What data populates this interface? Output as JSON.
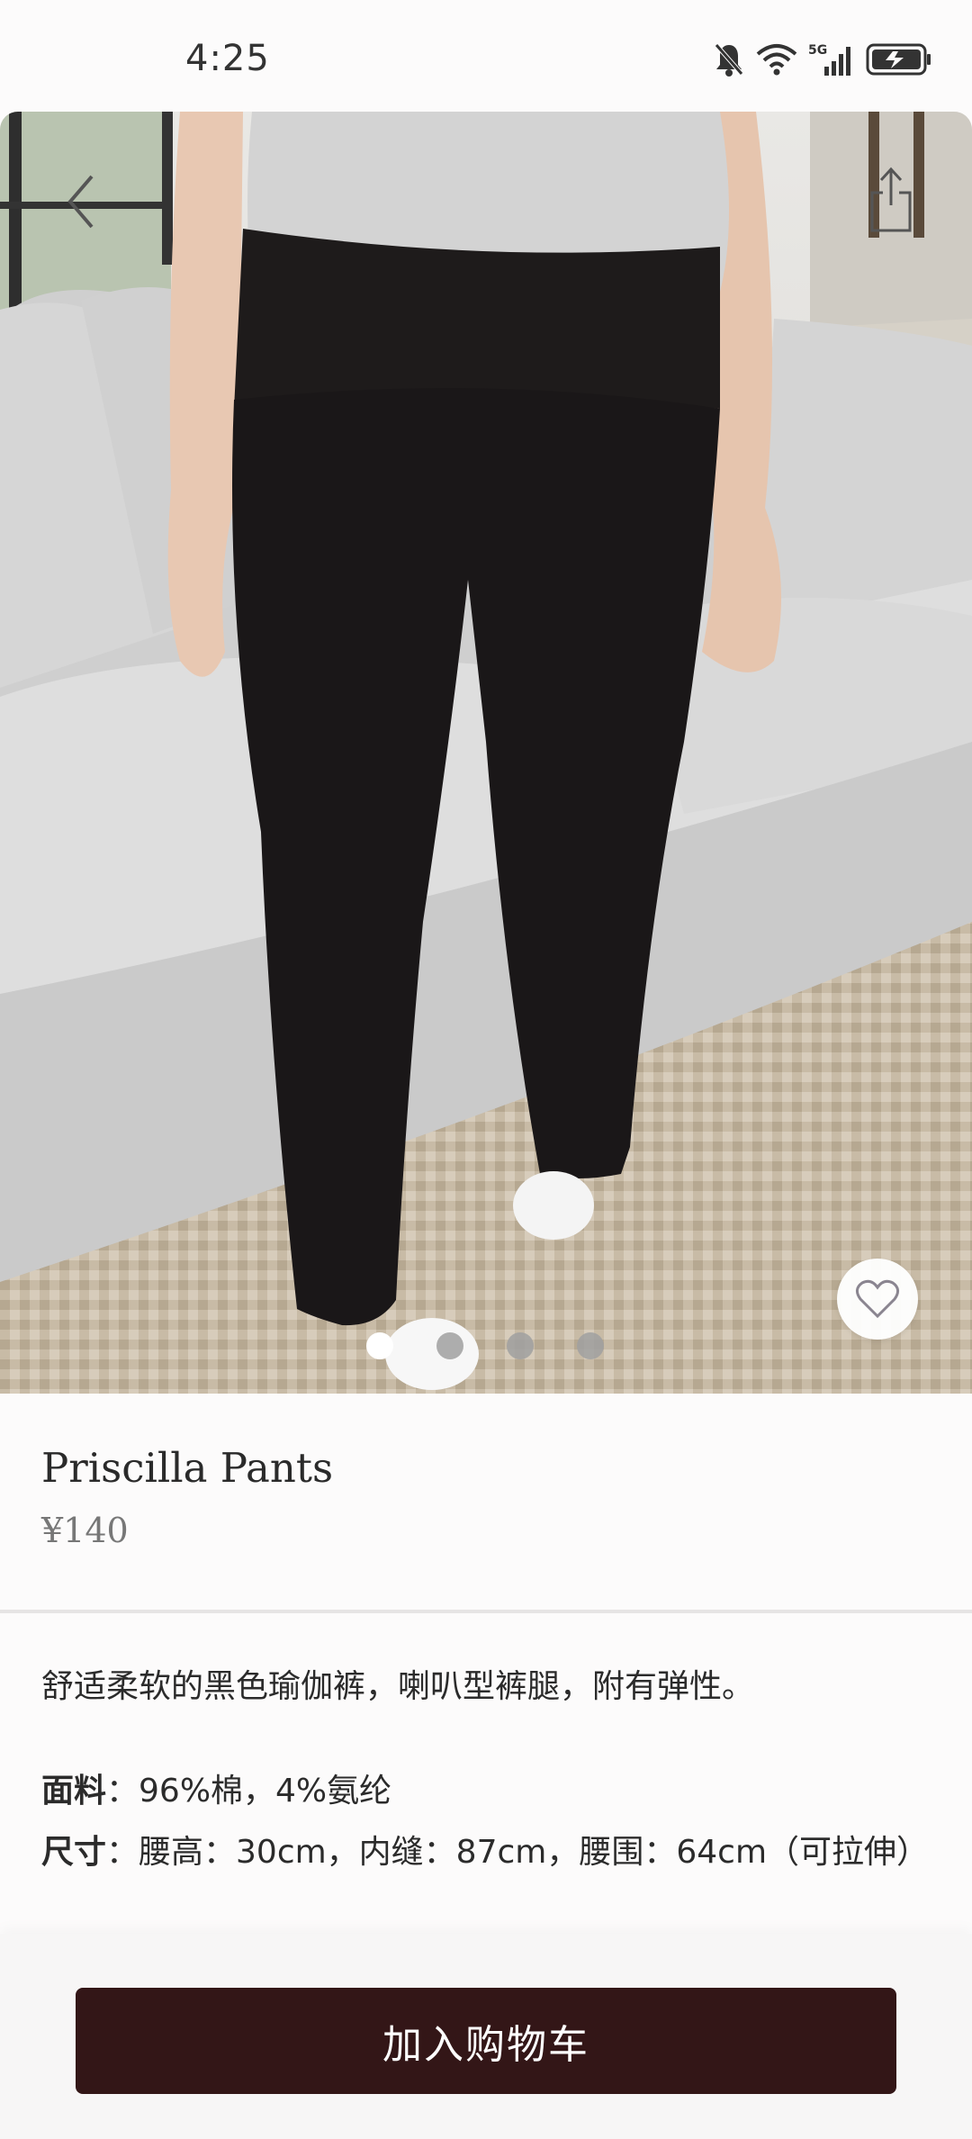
{
  "status_bar": {
    "time": "4:25",
    "network": "5G"
  },
  "hero": {
    "back_icon": "chevron-left-icon",
    "share_icon": "share-icon",
    "favorite_icon": "heart-outline-icon",
    "carousel": {
      "total": 4,
      "active_index": 0
    }
  },
  "product": {
    "title": "Priscilla Pants",
    "price": "¥140",
    "description": "舒适柔软的黑色瑜伽裤，喇叭型裤腿，附有弹性。",
    "material_label": "面料",
    "material_value": "：96%棉，4%氨纶",
    "size_label": "尺寸",
    "size_value": "：腰高：30cm，内缝：87cm，腰围：64cm（可拉伸）"
  },
  "actions": {
    "add_to_cart": "加入购物车"
  },
  "colors": {
    "button_bg": "#331617",
    "page_bg": "#fcfbfb"
  }
}
